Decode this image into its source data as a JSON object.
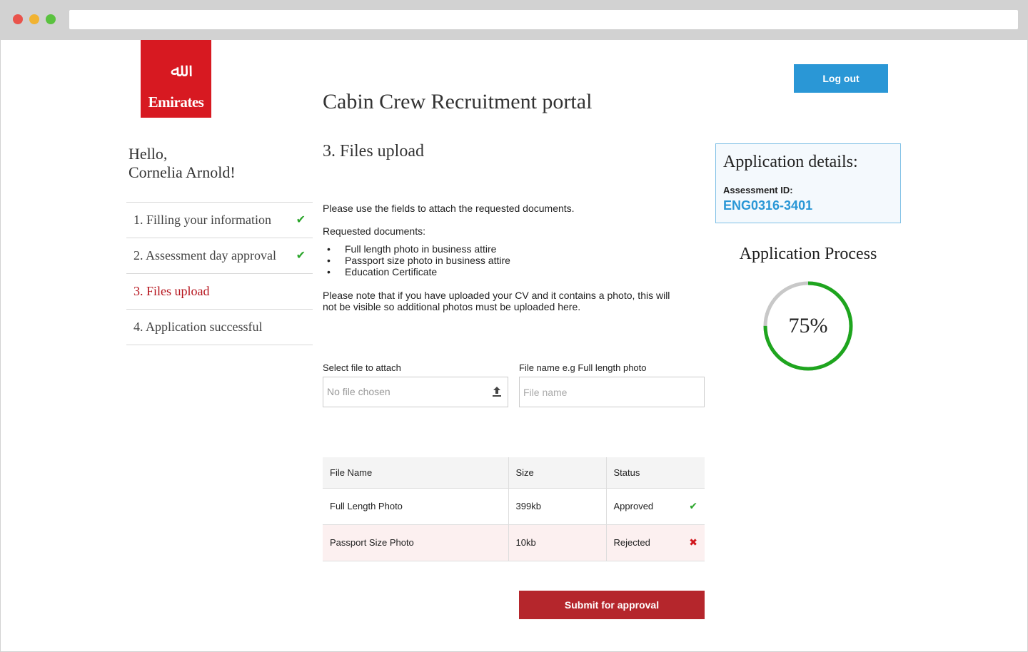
{
  "brand": {
    "logo_text": "Emirates",
    "logo_glyph": "ﷲ",
    "primary_color": "#d71921",
    "accent_color": "#2a97d6"
  },
  "header": {
    "portal_title": "Cabin Crew Recruitment portal",
    "logout_label": "Log out"
  },
  "sidebar": {
    "greeting_line1": "Hello,",
    "greeting_line2": "Cornelia Arnold!",
    "steps": [
      {
        "label": "1. Filling your information",
        "status": "complete",
        "icon": "check-icon"
      },
      {
        "label": "2. Assessment day approval",
        "status": "complete",
        "icon": "check-icon"
      },
      {
        "label": "3. Files upload",
        "status": "active"
      },
      {
        "label": "4. Application successful",
        "status": "pending"
      }
    ]
  },
  "main": {
    "section_title": "3. Files upload",
    "intro": "Please use the fields to attach the requested documents.",
    "requested_label": "Requested documents:",
    "documents": [
      "Full length photo in business attire",
      "Passport size photo in business attire",
      "Education Certificate"
    ],
    "note_line1": "Please note that if you have uploaded your CV and it contains a photo, this will",
    "note_line2": "not be visible so additional photos must be uploaded here.",
    "file_field": {
      "label": "Select file to attach",
      "value": "No file chosen",
      "icon": "upload-icon"
    },
    "name_field": {
      "label": "File name e.g Full length photo",
      "placeholder": "File name"
    },
    "table": {
      "headers": [
        "File Name",
        "Size",
        "Status"
      ],
      "rows": [
        {
          "name": "Full Length Photo",
          "size": "399kb",
          "status": "Approved",
          "icon": "check-icon"
        },
        {
          "name": "Passport Size Photo",
          "size": "10kb",
          "status": "Rejected",
          "icon": "cross-icon"
        }
      ]
    },
    "submit_label": "Submit for approval"
  },
  "details": {
    "title": "Application details:",
    "assessment_label": "Assessment ID:",
    "assessment_id": "ENG0316-3401"
  },
  "process": {
    "title": "Application Process",
    "progress": 0.75,
    "progress_label": "75%",
    "ring_color": "#1ea51e",
    "track_color": "#c8c8c8"
  }
}
